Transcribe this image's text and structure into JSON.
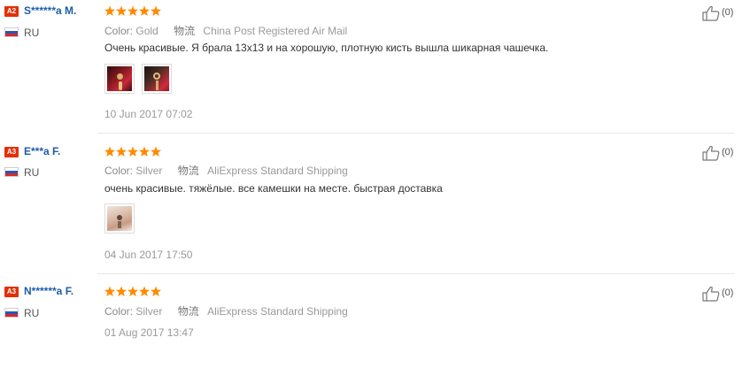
{
  "reviews": [
    {
      "level_badge": "A2",
      "buyer_name": "S******a M.",
      "country": "RU",
      "rating": 5,
      "color_label": "Color:",
      "color_value": "Gold",
      "logistics_icon": "物流",
      "logistics_value": "China Post Registered Air Mail",
      "feedback": "Очень красивые. Я брала 13x13 и на хорошую, плотную кисть вышла шикарная чашечка.",
      "photos": [
        "photo-earrings-red-1",
        "photo-earrings-red-2"
      ],
      "date": "10 Jun 2017 07:02",
      "helpful_count": "(0)"
    },
    {
      "level_badge": "A3",
      "buyer_name": "E***a F.",
      "country": "RU",
      "rating": 5,
      "color_label": "Color:",
      "color_value": "Silver",
      "logistics_icon": "物流",
      "logistics_value": "AliExpress Standard Shipping",
      "feedback": "очень красивые. тяжёлые. все камешки на месте. быстрая доставка",
      "photos": [
        "photo-earrings-hand"
      ],
      "date": "04 Jun 2017 17:50",
      "helpful_count": "(0)"
    },
    {
      "level_badge": "A3",
      "buyer_name": "N******a F.",
      "country": "RU",
      "rating": 5,
      "color_label": "Color:",
      "color_value": "Silver",
      "logistics_icon": "物流",
      "logistics_value": "AliExpress Standard Shipping",
      "feedback": "",
      "photos": [],
      "date": "01 Aug 2017 13:47",
      "helpful_count": "(0)"
    }
  ],
  "colors": {
    "badge": "#e62e04",
    "buyer_name": "#1a5daa",
    "star": "#ff8a00",
    "divider": "#e8e8e8"
  },
  "icons": {
    "thumbs_up": "thumbs-up-icon",
    "flag": "russia-flag-icon",
    "star": "star-icon"
  }
}
